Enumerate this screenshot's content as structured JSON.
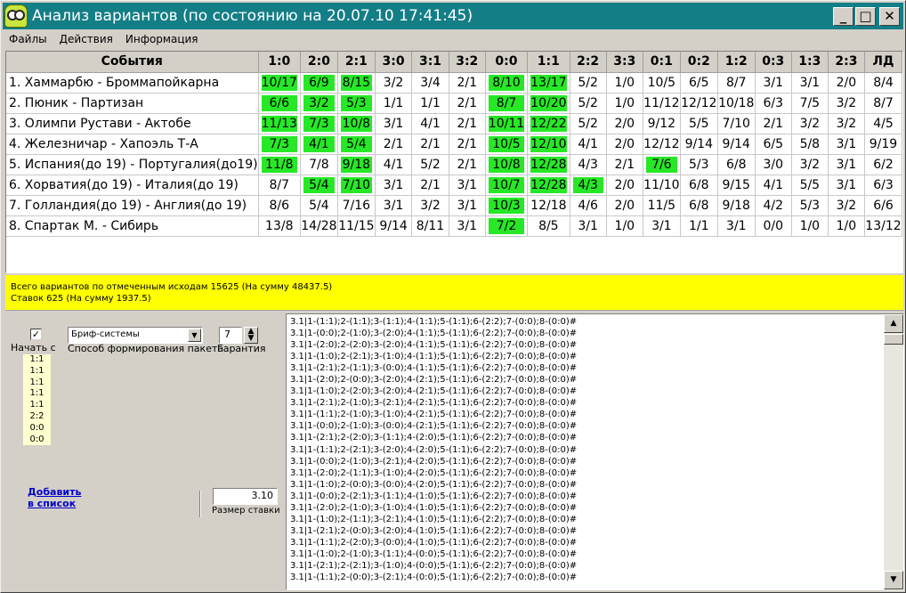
{
  "window": {
    "title": "Анализ вариантов (по состоянию на 20.07.10 17:41:45)",
    "minimize": "_",
    "maximize": "□",
    "close": "✕"
  },
  "menu": [
    "Файлы",
    "Действия",
    "Информация"
  ],
  "grid": {
    "header_event": "События",
    "headers": [
      "1:0",
      "2:0",
      "2:1",
      "3:0",
      "3:1",
      "3:2",
      "0:0",
      "1:1",
      "2:2",
      "3:3",
      "0:1",
      "0:2",
      "1:2",
      "0:3",
      "1:3",
      "2:3",
      "ЛД"
    ],
    "highlight_color": "#27e827",
    "rows": [
      {
        "event": "1. Хаммарбю - Броммапойкарна",
        "values": [
          "10/17",
          "6/9",
          "8/15",
          "3/2",
          "3/4",
          "2/1",
          "8/10",
          "13/17",
          "5/2",
          "1/0",
          "10/5",
          "6/5",
          "8/7",
          "3/1",
          "3/1",
          "2/0",
          "8/4"
        ],
        "highlight": [
          0,
          1,
          2,
          6,
          7
        ]
      },
      {
        "event": "2. Пюник - Партизан",
        "values": [
          "6/6",
          "3/2",
          "5/3",
          "1/1",
          "1/1",
          "2/1",
          "8/7",
          "10/20",
          "5/2",
          "1/0",
          "11/12",
          "12/12",
          "10/18",
          "6/3",
          "7/5",
          "3/2",
          "8/7"
        ],
        "highlight": [
          0,
          1,
          2,
          6,
          7
        ]
      },
      {
        "event": "3. Олимпи Рустави - Актобе",
        "values": [
          "11/13",
          "7/3",
          "10/8",
          "3/1",
          "4/1",
          "2/1",
          "10/11",
          "12/22",
          "5/2",
          "2/0",
          "9/12",
          "5/5",
          "7/10",
          "2/1",
          "3/2",
          "3/2",
          "4/5"
        ],
        "highlight": [
          0,
          1,
          2,
          6,
          7
        ]
      },
      {
        "event": "4. Железничар - Хапоэль Т-А",
        "values": [
          "7/3",
          "4/1",
          "5/4",
          "2/1",
          "2/1",
          "2/1",
          "10/5",
          "12/10",
          "4/1",
          "2/0",
          "12/12",
          "9/14",
          "9/14",
          "6/5",
          "5/8",
          "3/1",
          "9/19"
        ],
        "highlight": [
          0,
          1,
          2,
          6,
          7
        ]
      },
      {
        "event": "5. Испания(до 19) - Португалия(до19)",
        "values": [
          "11/8",
          "7/8",
          "9/18",
          "4/1",
          "5/2",
          "2/1",
          "10/8",
          "12/28",
          "4/3",
          "2/1",
          "7/6",
          "5/3",
          "6/8",
          "3/0",
          "3/2",
          "3/1",
          "6/2"
        ],
        "highlight": [
          0,
          2,
          6,
          7,
          10
        ]
      },
      {
        "event": "6. Хорватия(до 19) - Италия(до 19)",
        "values": [
          "8/7",
          "5/4",
          "7/10",
          "3/1",
          "2/1",
          "3/1",
          "10/7",
          "12/28",
          "4/3",
          "2/0",
          "11/10",
          "6/8",
          "9/15",
          "4/1",
          "5/5",
          "3/1",
          "6/3"
        ],
        "highlight": [
          1,
          2,
          6,
          7,
          8
        ]
      },
      {
        "event": "7. Голландия(до 19) - Англия(до 19)",
        "values": [
          "8/6",
          "5/4",
          "7/16",
          "3/1",
          "3/2",
          "3/1",
          "10/3",
          "12/18",
          "4/6",
          "2/0",
          "11/5",
          "6/8",
          "9/18",
          "4/2",
          "5/3",
          "3/2",
          "6/6"
        ],
        "highlight": [
          6
        ]
      },
      {
        "event": "8. Спартак М. - Сибирь",
        "values": [
          "13/8",
          "14/28",
          "11/15",
          "9/14",
          "8/11",
          "3/1",
          "7/2",
          "8/5",
          "3/1",
          "1/0",
          "3/1",
          "1/1",
          "3/1",
          "0/0",
          "1/0",
          "1/0",
          "13/12"
        ],
        "highlight": [
          6
        ]
      }
    ]
  },
  "summary": {
    "line1": "Всего вариантов по отмеченным исходам 15625 (На сумму 48437.5)",
    "line2": "Ставок  625 (На сумму 1937.5)"
  },
  "panel": {
    "start_checked": "✓",
    "start_label": "Начать с",
    "start_values": [
      "1:1",
      "1:1",
      "1:1",
      "1:1",
      "1:1",
      "2:2",
      "0:0",
      "0:0"
    ],
    "method_value": "Бриф-системы",
    "method_label": "Способ формирования пакета",
    "guarantee_value": "7",
    "guarantee_label": "Гарантия",
    "add_link_line1": "Добавить",
    "add_link_line2": "в список",
    "stake_value": "3.10",
    "stake_label": "Размер ставки"
  },
  "output_lines": [
    "3.1|1-(1:1);2-(1:1);3-(1:1);4-(1:1);5-(1:1);6-(2:2);7-(0:0);8-(0:0)#",
    "3.1|1-(0:0);2-(1:0);3-(2:0);4-(1:1);5-(1:1);6-(2:2);7-(0:0);8-(0:0)#",
    "3.1|1-(2:0);2-(2:0);3-(2:0);4-(1:1);5-(1:1);6-(2:2);7-(0:0);8-(0:0)#",
    "3.1|1-(1:0);2-(2:1);3-(1:0);4-(1:1);5-(1:1);6-(2:2);7-(0:0);8-(0:0)#",
    "3.1|1-(2:1);2-(1:1);3-(0:0);4-(1:1);5-(1:1);6-(2:2);7-(0:0);8-(0:0)#",
    "3.1|1-(2:0);2-(0:0);3-(2:0);4-(2:1);5-(1:1);6-(2:2);7-(0:0);8-(0:0)#",
    "3.1|1-(1:0);2-(2:0);3-(2:0);4-(2:1);5-(1:1);6-(2:2);7-(0:0);8-(0:0)#",
    "3.1|1-(2:1);2-(1:0);3-(2:1);4-(2:1);5-(1:1);6-(2:2);7-(0:0);8-(0:0)#",
    "3.1|1-(1:1);2-(1:0);3-(1:0);4-(2:1);5-(1:1);6-(2:2);7-(0:0);8-(0:0)#",
    "3.1|1-(0:0);2-(1:0);3-(0:0);4-(2:1);5-(1:1);6-(2:2);7-(0:0);8-(0:0)#",
    "3.1|1-(2:1);2-(2:0);3-(1:1);4-(2:0);5-(1:1);6-(2:2);7-(0:0);8-(0:0)#",
    "3.1|1-(1:1);2-(2:1);3-(2:0);4-(2:0);5-(1:1);6-(2:2);7-(0:0);8-(0:0)#",
    "3.1|1-(0:0);2-(1:0);3-(2:1);4-(2:0);5-(1:1);6-(2:2);7-(0:0);8-(0:0)#",
    "3.1|1-(2:0);2-(1:1);3-(1:0);4-(2:0);5-(1:1);6-(2:2);7-(0:0);8-(0:0)#",
    "3.1|1-(1:0);2-(0:0);3-(0:0);4-(2:0);5-(1:1);6-(2:2);7-(0:0);8-(0:0)#",
    "3.1|1-(0:0);2-(2:1);3-(1:1);4-(1:0);5-(1:1);6-(2:2);7-(0:0);8-(0:0)#",
    "3.1|1-(2:0);2-(1:0);3-(1:0);4-(1:0);5-(1:1);6-(2:2);7-(0:0);8-(0:0)#",
    "3.1|1-(1:0);2-(1:1);3-(2:1);4-(1:0);5-(1:1);6-(2:2);7-(0:0);8-(0:0)#",
    "3.1|1-(2:1);2-(0:0);3-(2:0);4-(1:0);5-(1:1);6-(2:2);7-(0:0);8-(0:0)#",
    "3.1|1-(1:1);2-(2:0);3-(0:0);4-(1:0);5-(1:1);6-(2:2);7-(0:0);8-(0:0)#",
    "3.1|1-(1:0);2-(1:0);3-(1:1);4-(0:0);5-(1:1);6-(2:2);7-(0:0);8-(0:0)#",
    "3.1|1-(2:1);2-(2:1);3-(1:0);4-(0:0);5-(1:1);6-(2:2);7-(0:0);8-(0:0)#",
    "3.1|1-(1:1);2-(0:0);3-(2:1);4-(0:0);5-(1:1);6-(2:2);7-(0:0);8-(0:0)#"
  ],
  "scrollbar": {
    "up": "▲",
    "down": "▼"
  }
}
